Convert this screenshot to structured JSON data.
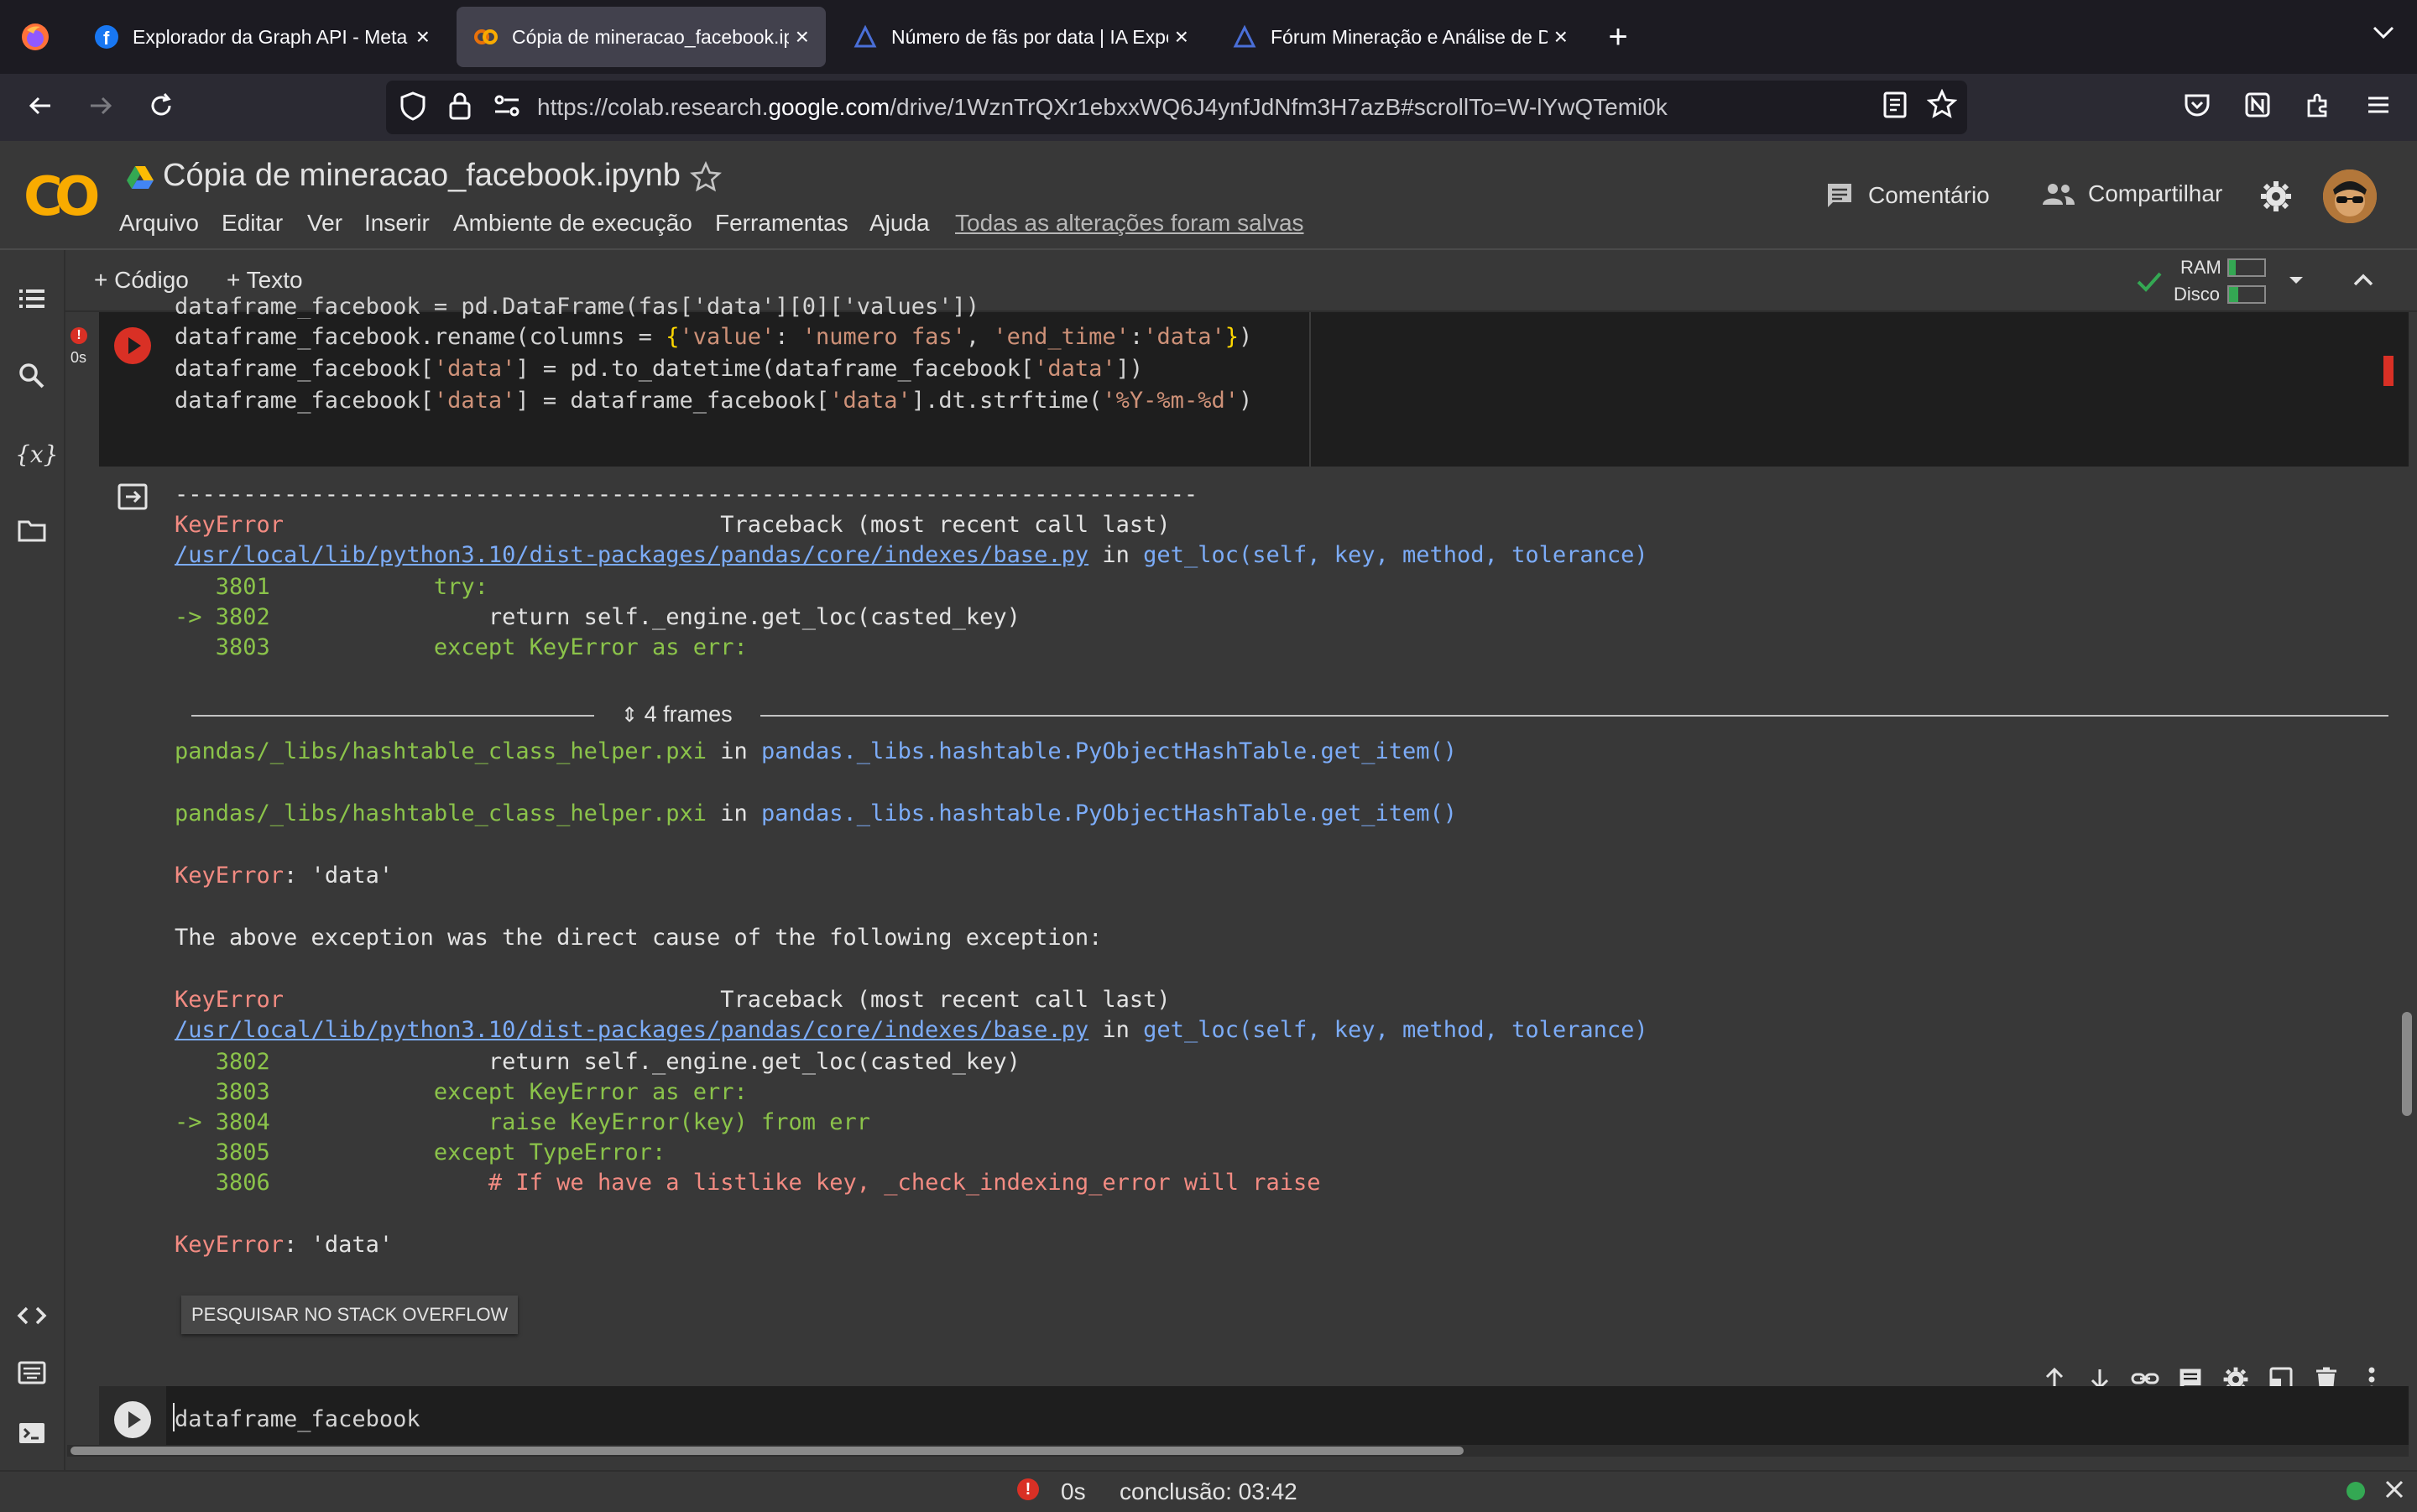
{
  "browser": {
    "tabs": [
      {
        "title": "Explorador da Graph API - Meta",
        "active": false
      },
      {
        "title": "Cópia de mineracao_facebook.ip",
        "active": true
      },
      {
        "title": "Número de fãs por data | IA Expe",
        "active": false
      },
      {
        "title": "Fórum Mineração e Análise de D",
        "active": false
      }
    ],
    "url_prefix": "https://colab.research.",
    "url_domain": "google.com",
    "url_suffix": "/drive/1WznTrQXr1ebxxWQ6J4ynfJdNfm3H7azB#scrollTo=W-lYwQTemi0k"
  },
  "colab": {
    "logo_text": "CO",
    "doc_title": "Cópia de mineracao_facebook.ipynb",
    "menu": [
      "Arquivo",
      "Editar",
      "Ver",
      "Inserir",
      "Ambiente de execução",
      "Ferramentas",
      "Ajuda"
    ],
    "saved_status": "Todas as alterações foram salvas",
    "comment_label": "Comentário",
    "share_label": "Compartilhar",
    "toolbar": {
      "add_code": "+ Código",
      "add_text": "+ Texto",
      "ram_label": "RAM",
      "disk_label": "Disco"
    }
  },
  "cell1": {
    "exec_time": "0s",
    "lines": [
      "dataframe_facebook = pd.DataFrame(fas['data'][0]['values'])",
      "dataframe_facebook.rename(columns = {'value': 'numero fas', 'end_time':'data'})",
      "dataframe_facebook['data'] = pd.to_datetime(dataframe_facebook['data'])",
      "dataframe_facebook['data'] = dataframe_facebook['data'].dt.strftime('%Y-%m-%d')"
    ]
  },
  "output": {
    "dashes": "---------------------------------------------------------------------------",
    "err1_name": "KeyError",
    "traceback_header": "Traceback (most recent call last)",
    "file_path": "/usr/local/lib/python3.10/dist-packages/pandas/core/indexes/base.py",
    "in_word": "in",
    "func_sig": "get_loc(self, key, method, tolerance)",
    "block1": [
      {
        "arrow": "",
        "num": "3801",
        "code": "            try:"
      },
      {
        "arrow": "->",
        "num": "3802",
        "code": "                return self._engine.get_loc(casted_key)"
      },
      {
        "arrow": "",
        "num": "3803",
        "code": "            except KeyError as err:"
      }
    ],
    "frames_label": "4 frames",
    "hashtable_file": "pandas/_libs/hashtable_class_helper.pxi",
    "hashtable_func": "pandas._libs.hashtable.PyObjectHashTable.get_item()",
    "key_error_msg": ": 'data'",
    "cause_msg": "The above exception was the direct cause of the following exception:",
    "block2": [
      {
        "arrow": "",
        "num": "3802",
        "code": "                return self._engine.get_loc(casted_key)"
      },
      {
        "arrow": "",
        "num": "3803",
        "code": "            except KeyError as err:"
      },
      {
        "arrow": "->",
        "num": "3804",
        "code": "                raise KeyError(key) from err"
      },
      {
        "arrow": "",
        "num": "3805",
        "code": "            except TypeError:"
      },
      {
        "arrow": "",
        "num": "3806",
        "code": "                # If we have a listlike key, _check_indexing_error will raise"
      }
    ],
    "so_button": "PESQUISAR NO STACK OVERFLOW"
  },
  "cell2": {
    "code": "dataframe_facebook"
  },
  "status": {
    "exec_time": "0s",
    "completion": "conclusão: 03:42"
  },
  "colors": {
    "accent_orange": "#f9ab00",
    "error_red": "#f28b82",
    "link_blue": "#7cacf8",
    "line_green": "#8bc34a",
    "ok_green": "#34a853"
  }
}
